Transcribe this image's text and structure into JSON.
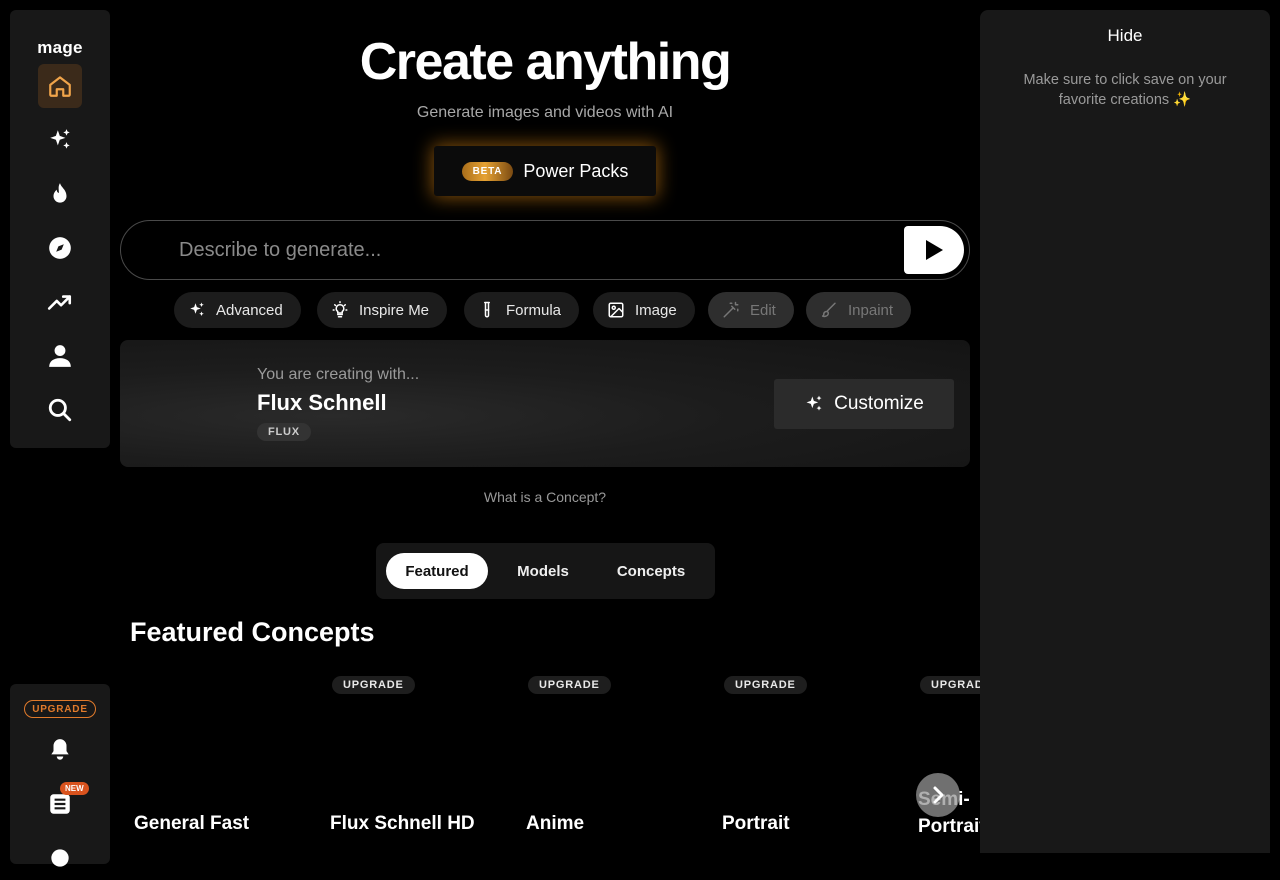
{
  "sidebar": {
    "logo": "mage",
    "nav_items": [
      {
        "icon": "home-icon",
        "active": true
      },
      {
        "icon": "sparkles-icon"
      },
      {
        "icon": "fire-icon"
      },
      {
        "icon": "compass-icon"
      },
      {
        "icon": "trending-icon"
      },
      {
        "icon": "user-icon"
      },
      {
        "icon": "search-icon"
      }
    ],
    "bottom": {
      "upgrade_label": "UPGRADE",
      "new_badge": "NEW",
      "icons": [
        "bell-icon",
        "news-icon",
        "gear-icon"
      ]
    }
  },
  "hero": {
    "title": "Create anything",
    "subtitle": "Generate images and videos with AI",
    "beta_label": "BETA",
    "power_label": "Power Packs"
  },
  "prompt": {
    "placeholder": "Describe to generate..."
  },
  "chips": {
    "advanced": "Advanced",
    "inspire": "Inspire Me",
    "formula": "Formula",
    "image": "Image",
    "edit": "Edit",
    "inpaint": "Inpaint"
  },
  "concept": {
    "pre_label": "You are creating with...",
    "name": "Flux Schnell",
    "tag": "FLUX",
    "customize_label": "Customize",
    "what_link": "What is a Concept?"
  },
  "tabs": {
    "featured": "Featured",
    "models": "Models",
    "concepts": "Concepts",
    "selected": "Featured"
  },
  "section": {
    "title": "Featured Concepts"
  },
  "cards": [
    {
      "name": "General Fast",
      "badge": ""
    },
    {
      "name": "Flux Schnell HD",
      "badge": "UPGRADE"
    },
    {
      "name": "Anime",
      "badge": "UPGRADE"
    },
    {
      "name": "Portrait",
      "badge": "UPGRADE"
    },
    {
      "name": "Semi-Portrait",
      "badge": "UPGRADE"
    }
  ],
  "right_panel": {
    "hide_label": "Hide",
    "message": "Make sure to click save on your favorite creations ✨"
  },
  "colors": {
    "accent_orange": "#e07a2b",
    "active_nav_bg": "#3b2a1a",
    "panel_bg": "#181818"
  }
}
